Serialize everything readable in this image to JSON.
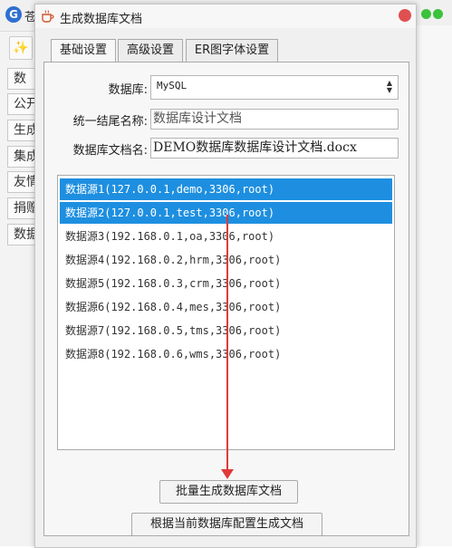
{
  "background_app": {
    "title_fragment": "苍",
    "nav_items": [
      "数",
      "公开",
      "生成",
      "集成",
      "友情",
      "捐赠",
      "数据"
    ]
  },
  "dialog": {
    "title": "生成数据库文档",
    "tabs": [
      {
        "label": "基础设置",
        "active": true
      },
      {
        "label": "高级设置",
        "active": false
      },
      {
        "label": "ER图字体设置",
        "active": false
      }
    ],
    "form": {
      "database_label": "数据库:",
      "database_value": "MySQL",
      "ending_name_label": "统一结尾名称:",
      "ending_name_placeholder": "数据库设计文档",
      "filename_label": "数据库文档名:",
      "filename_value": "DEMO数据库数据库设计文档.docx"
    },
    "datasources": [
      {
        "label": "数据源1(127.0.0.1,demo,3306,root)",
        "selected": true
      },
      {
        "label": "数据源2(127.0.0.1,test,3306,root)",
        "selected": true
      },
      {
        "label": "数据源3(192.168.0.1,oa,3306,root)",
        "selected": false
      },
      {
        "label": "数据源4(192.168.0.2,hrm,3306,root)",
        "selected": false
      },
      {
        "label": "数据源5(192.168.0.3,crm,3306,root)",
        "selected": false
      },
      {
        "label": "数据源6(192.168.0.4,mes,3306,root)",
        "selected": false
      },
      {
        "label": "数据源7(192.168.0.5,tms,3306,root)",
        "selected": false
      },
      {
        "label": "数据源8(192.168.0.6,wms,3306,root)",
        "selected": false
      }
    ],
    "batch_button": "批量生成数据库文档",
    "current_button": "根据当前数据库配置生成文档"
  },
  "colors": {
    "selection": "#1e8fe0",
    "annotation_arrow": "#e03a3a",
    "close_button": "#e05050"
  }
}
